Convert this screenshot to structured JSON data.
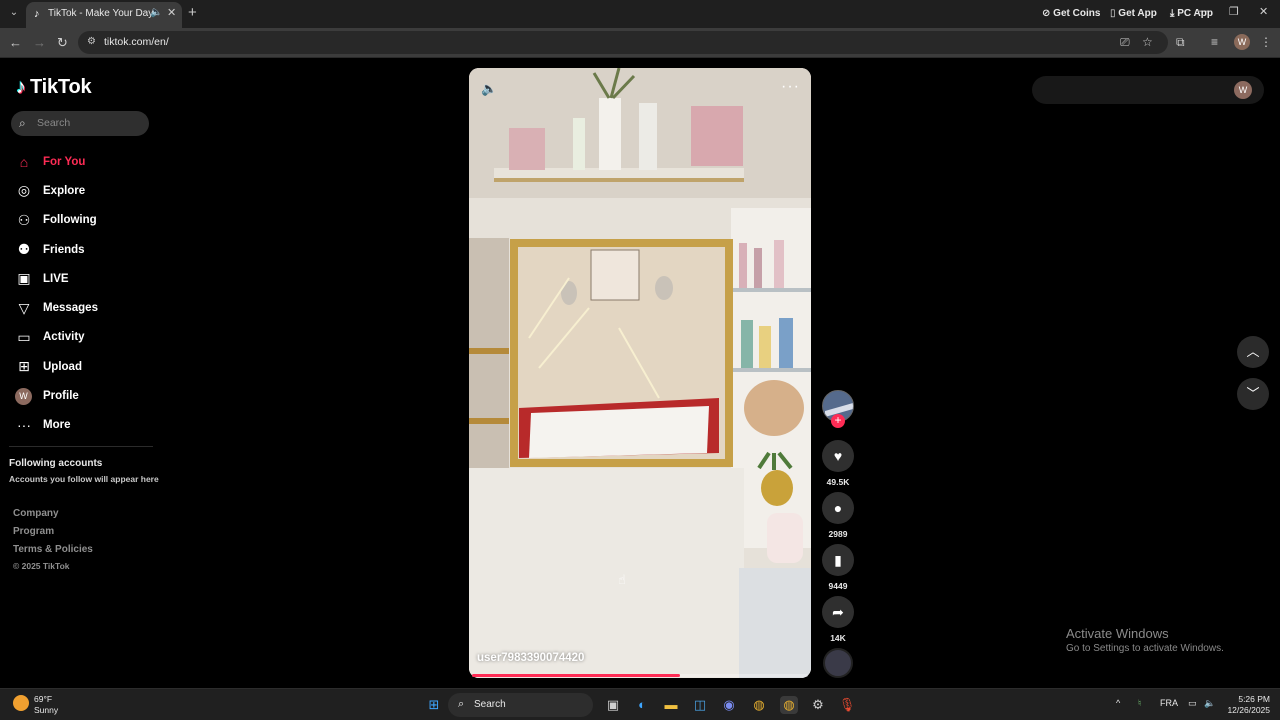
{
  "browser": {
    "tab_title": "TikTok - Make Your Day",
    "url": "tiktok.com/en/",
    "profile_initial": "W"
  },
  "sidebar": {
    "logo": "TikTok",
    "search_placeholder": "Search",
    "items": [
      {
        "label": "For You",
        "icon": "home-icon",
        "active": true
      },
      {
        "label": "Explore",
        "icon": "compass-icon"
      },
      {
        "label": "Following",
        "icon": "following-icon"
      },
      {
        "label": "Friends",
        "icon": "friends-icon"
      },
      {
        "label": "LIVE",
        "icon": "live-icon"
      },
      {
        "label": "Messages",
        "icon": "messages-icon"
      },
      {
        "label": "Activity",
        "icon": "activity-icon"
      },
      {
        "label": "Upload",
        "icon": "upload-icon"
      },
      {
        "label": "Profile",
        "icon": "profile-avatar"
      },
      {
        "label": "More",
        "icon": "more-icon"
      }
    ],
    "profile_initial": "W",
    "following_title": "Following accounts",
    "following_subtitle": "Accounts you follow will appear here",
    "footer_links": [
      "Company",
      "Program",
      "Terms & Policies"
    ],
    "copyright": "© 2025 TikTok"
  },
  "video": {
    "username": "user7983390074420",
    "progress_fraction": 0.62
  },
  "actions": {
    "likes": "49.5K",
    "comments": "2989",
    "saves": "9449",
    "shares": "14K"
  },
  "top_right": {
    "get_coins": "Get Coins",
    "get_app": "Get App",
    "pc_app": "PC App",
    "profile_initial": "W"
  },
  "watermark": {
    "line1": "Activate Windows",
    "line2": "Go to Settings to activate Windows."
  },
  "taskbar": {
    "weather_temp": "69°F",
    "weather_desc": "Sunny",
    "search_placeholder": "Search",
    "language": "FRA",
    "time": "5:26 PM",
    "date": "12/26/2025"
  },
  "colors": {
    "accent": "#fe2c55",
    "background": "#000000"
  }
}
